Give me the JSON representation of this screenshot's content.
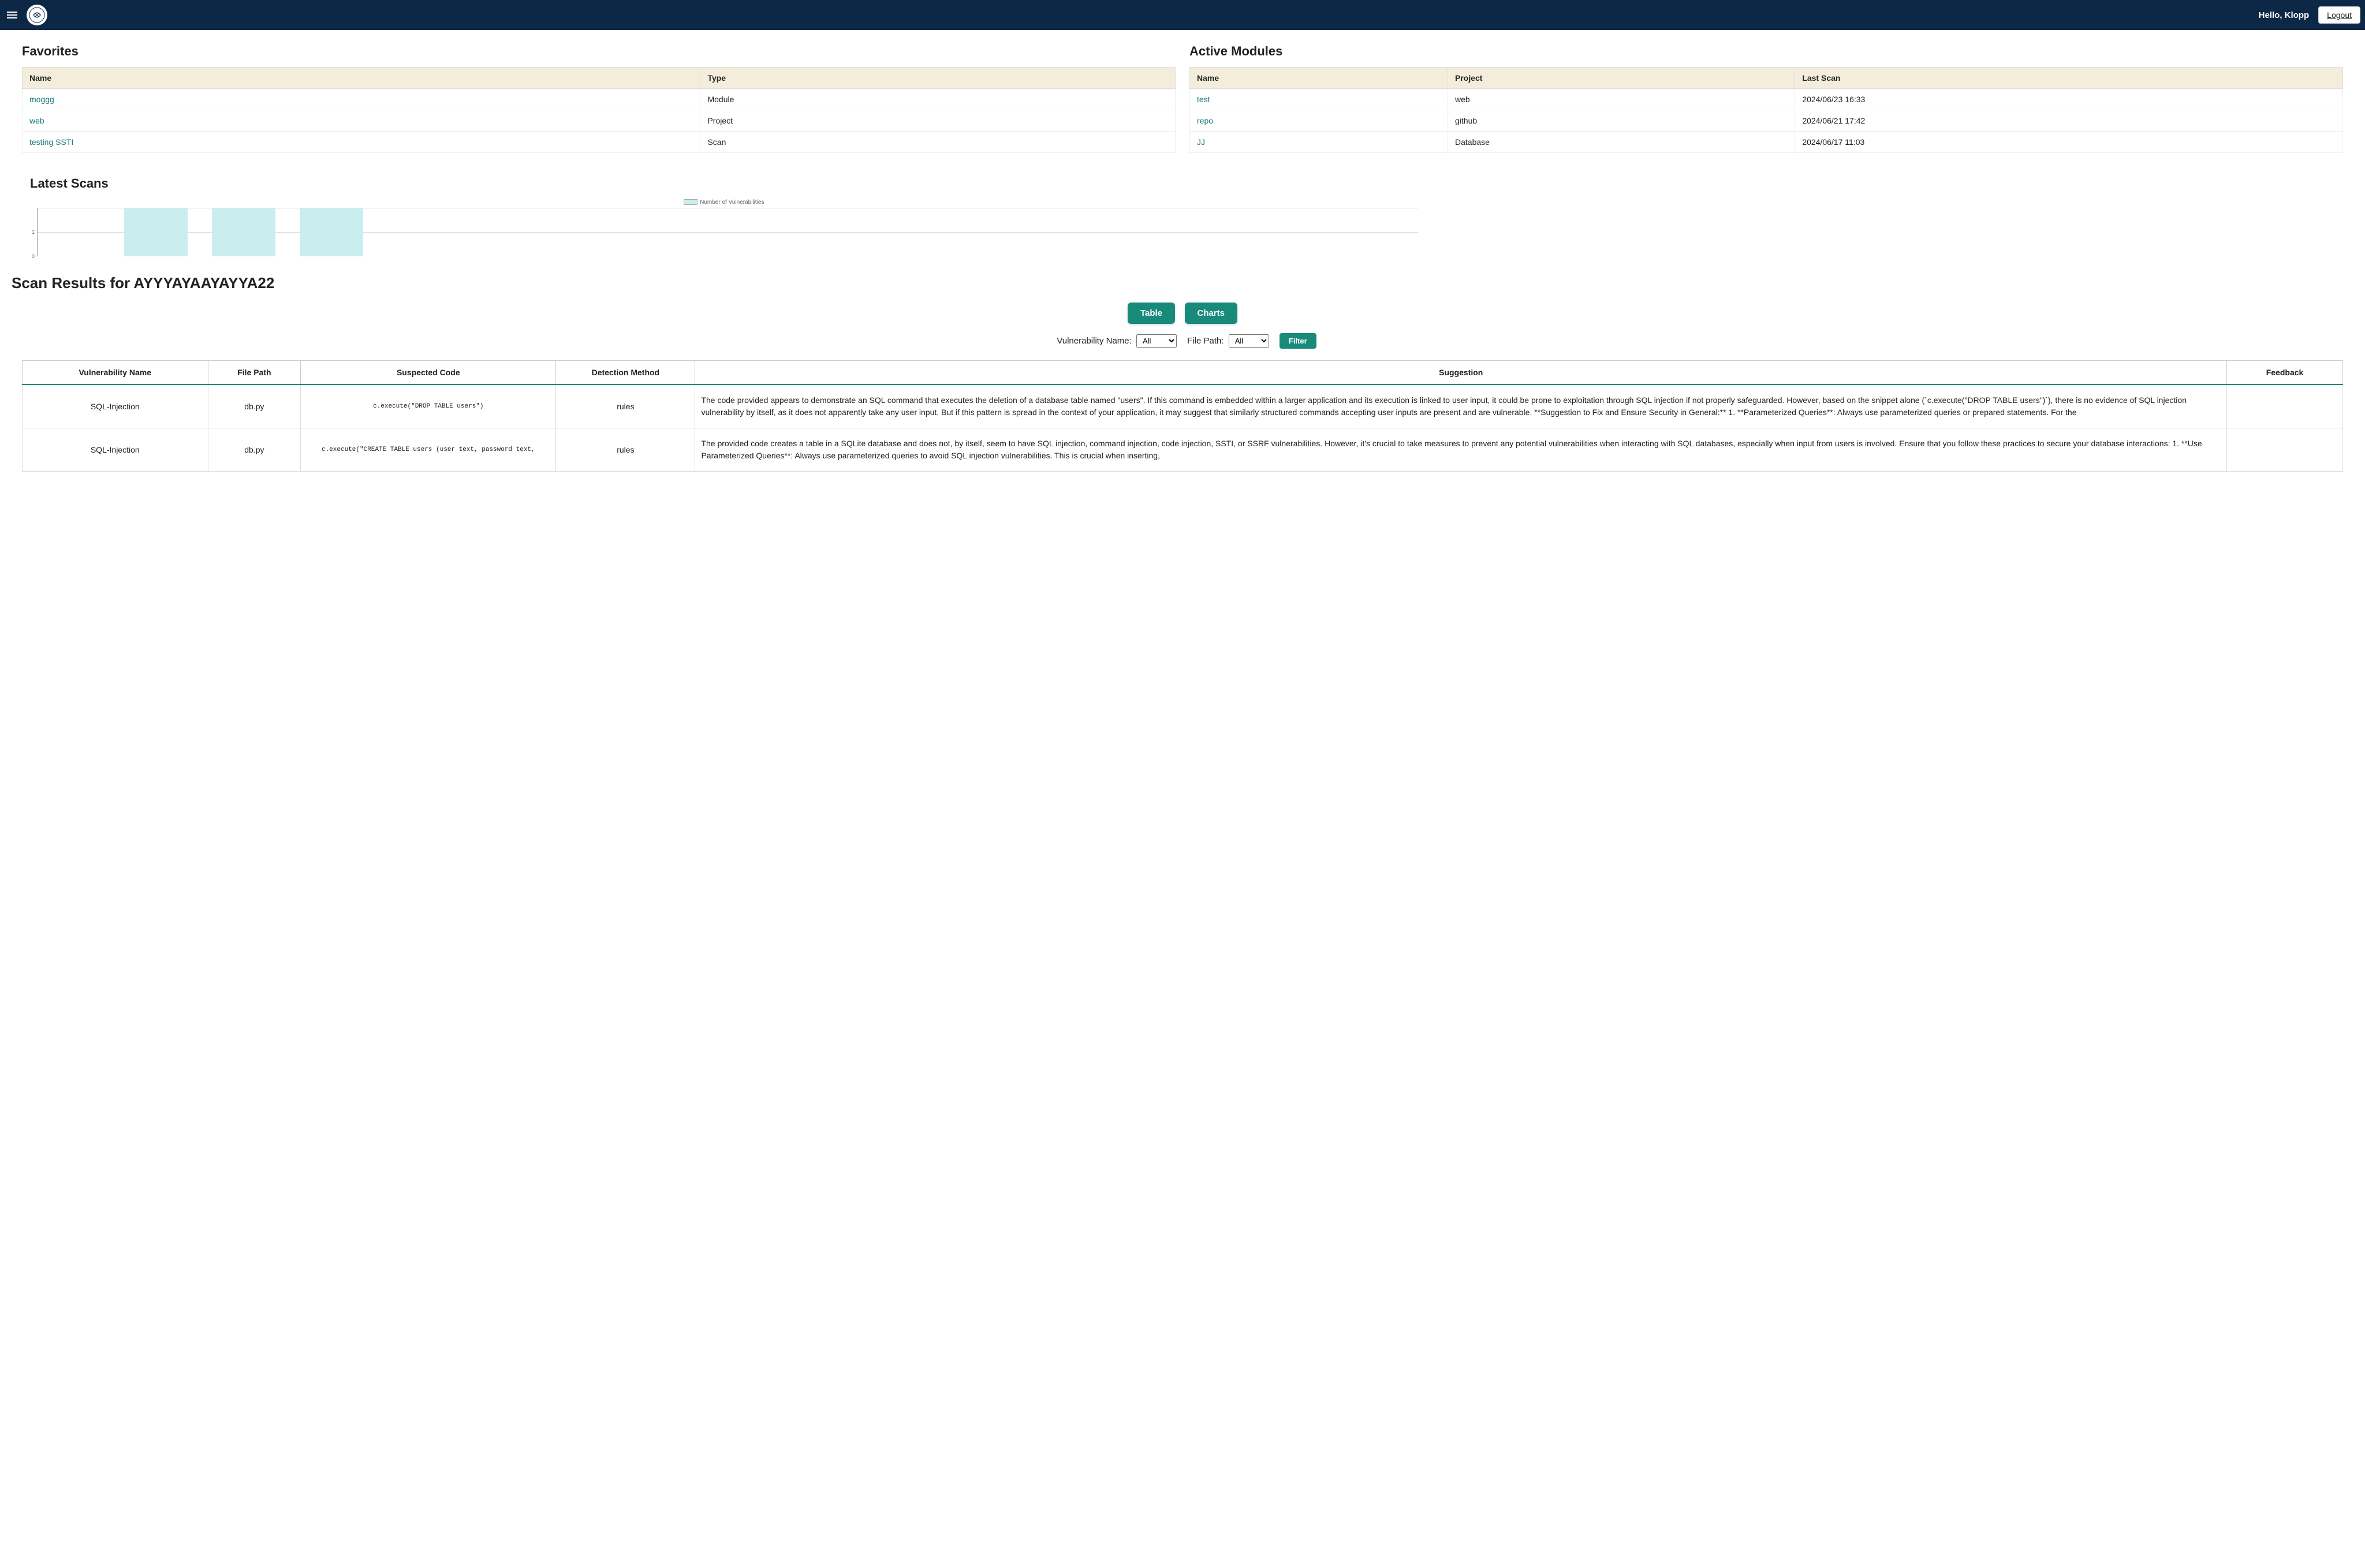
{
  "header": {
    "greeting": "Hello, Klopp",
    "logout": "Logout"
  },
  "favorites": {
    "title": "Favorites",
    "cols": {
      "name": "Name",
      "type": "Type"
    },
    "rows": [
      {
        "name": "moggg",
        "type": "Module"
      },
      {
        "name": "web",
        "type": "Project"
      },
      {
        "name": "testing SSTI",
        "type": "Scan"
      }
    ]
  },
  "active_modules": {
    "title": "Active Modules",
    "cols": {
      "name": "Name",
      "project": "Project",
      "last_scan": "Last Scan"
    },
    "rows": [
      {
        "name": "test",
        "project": "web",
        "last_scan": "2024/06/23 16:33"
      },
      {
        "name": "repo",
        "project": "github",
        "last_scan": "2024/06/21 17:42"
      },
      {
        "name": "JJ",
        "project": "Database",
        "last_scan": "2024/06/17 11:03"
      }
    ]
  },
  "latest_scans": {
    "title": "Latest Scans",
    "legend": "Number of Vulnerabilities"
  },
  "chart_data": {
    "type": "bar",
    "legend": "Number of Vulnerabilities",
    "yticks": [
      0,
      1
    ],
    "ylim": [
      0,
      2
    ],
    "categories": [
      "",
      "",
      ""
    ],
    "values": [
      2,
      2,
      2
    ]
  },
  "scan_results": {
    "title": "Scan Results for AYYYAYAAYAYYA22",
    "table_btn": "Table",
    "charts_btn": "Charts",
    "filter": {
      "vuln_label": "Vulnerability Name:",
      "vuln_selected": "All",
      "path_label": "File Path:",
      "path_selected": "All",
      "filter_btn": "Filter"
    },
    "cols": {
      "vuln": "Vulnerability Name",
      "path": "File Path",
      "code": "Suspected Code",
      "method": "Detection Method",
      "suggestion": "Suggestion",
      "feedback": "Feedback"
    },
    "rows": [
      {
        "vuln": "SQL-Injection",
        "path": "db.py",
        "code": "c.execute(\"DROP TABLE users\")",
        "method": "rules",
        "suggestion": "The code provided appears to demonstrate an SQL command that executes the deletion of a database table named \"users\". If this command is embedded within a larger application and its execution is linked to user input, it could be prone to exploitation through SQL injection if not properly safeguarded. However, based on the snippet alone (`c.execute(\"DROP TABLE users\")`), there is no evidence of SQL injection vulnerability by itself, as it does not apparently take any user input. But if this pattern is spread in the context of your application, it may suggest that similarly structured commands accepting user inputs are present and are vulnerable. **Suggestion to Fix and Ensure Security in General:** 1. **Parameterized Queries**: Always use parameterized queries or prepared statements. For the"
      },
      {
        "vuln": "SQL-Injection",
        "path": "db.py",
        "code": "c.execute(\"CREATE TABLE users (user text, password text,",
        "method": "rules",
        "suggestion": "The provided code creates a table in a SQLite database and does not, by itself, seem to have SQL injection, command injection, code injection, SSTI, or SSRF vulnerabilities. However, it's crucial to take measures to prevent any potential vulnerabilities when interacting with SQL databases, especially when input from users is involved. Ensure that you follow these practices to secure your database interactions: 1. **Use Parameterized Queries**: Always use parameterized queries to avoid SQL injection vulnerabilities. This is crucial when inserting,"
      }
    ]
  }
}
